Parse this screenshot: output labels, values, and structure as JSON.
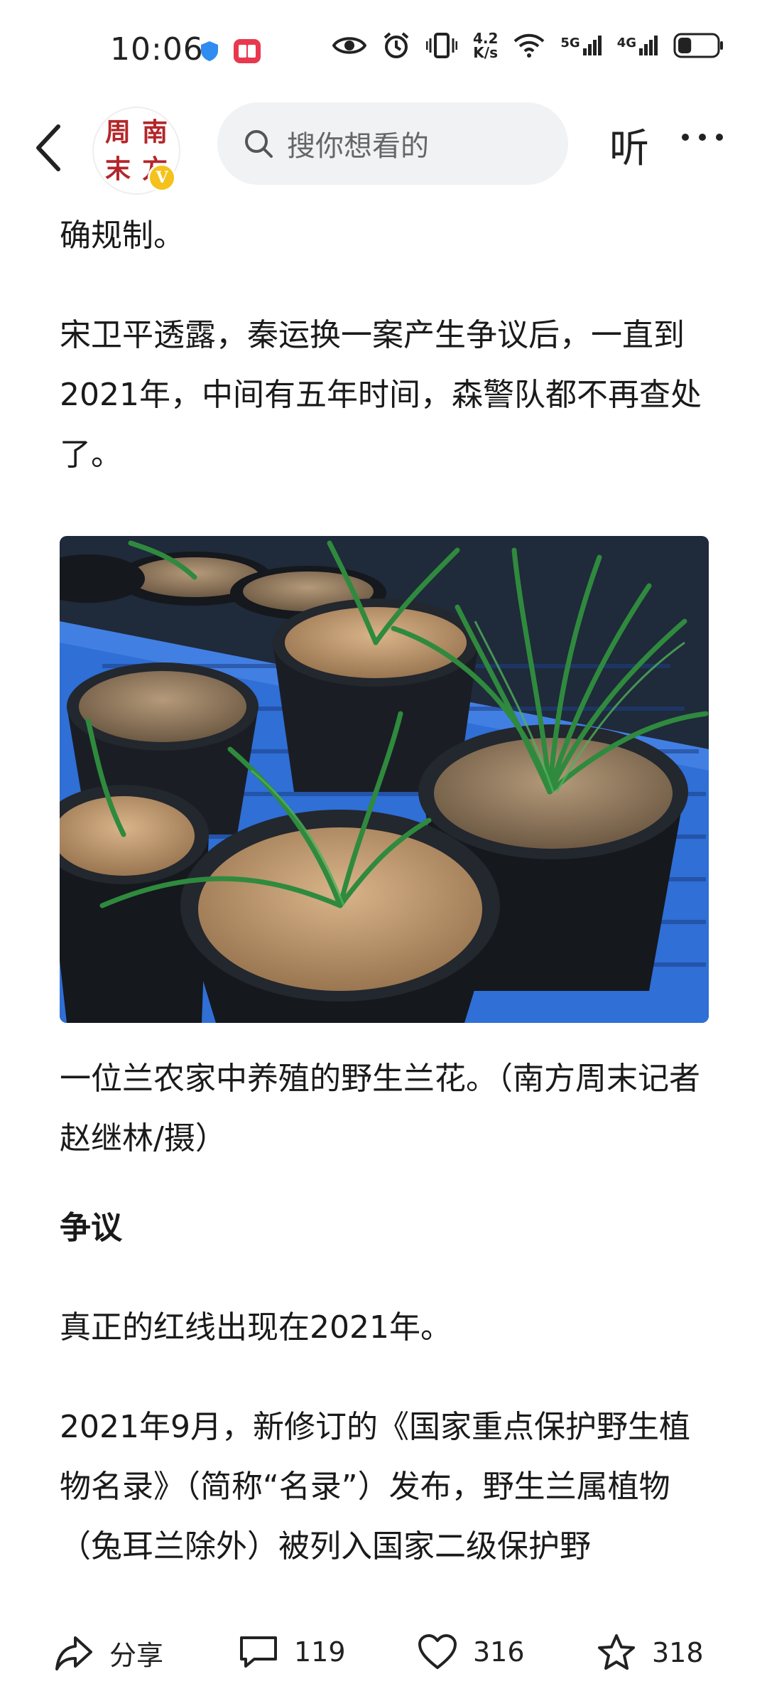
{
  "status_bar": {
    "time": "10:06",
    "net_speed_value": "4.2",
    "net_speed_unit": "K/s",
    "network_1": "5G",
    "network_2": "4G",
    "battery_percent": 35
  },
  "nav": {
    "logo_chars": [
      "周",
      "南",
      "末",
      "方"
    ],
    "verified_badge": "V",
    "search_placeholder": "搜你想看的",
    "listen_label": "听"
  },
  "article": {
    "p_top": "确规制。",
    "p1": "宋卫平透露，秦运换一案产生争议后，一直到2021年，中间有五年时间，森警队都不再查处了。",
    "caption": "一位兰农家中养殖的野生兰花。（南方周末记者 赵继林/摄）",
    "heading": "争议",
    "p2": "真正的红线出现在2021年。",
    "p3": "2021年9月，新修订的《国家重点保护野生植物名录》（简称“名录”）发布，野生兰属植物（兔耳兰除外）被列入国家二级保护野"
  },
  "bottom_bar": {
    "share_label": "分享",
    "comments_count": "119",
    "likes_count": "316",
    "favorites_count": "318"
  },
  "colors": {
    "brand_red": "#b3262a",
    "badge_yellow": "#f4c21b",
    "search_bg": "#f1f2f4"
  }
}
